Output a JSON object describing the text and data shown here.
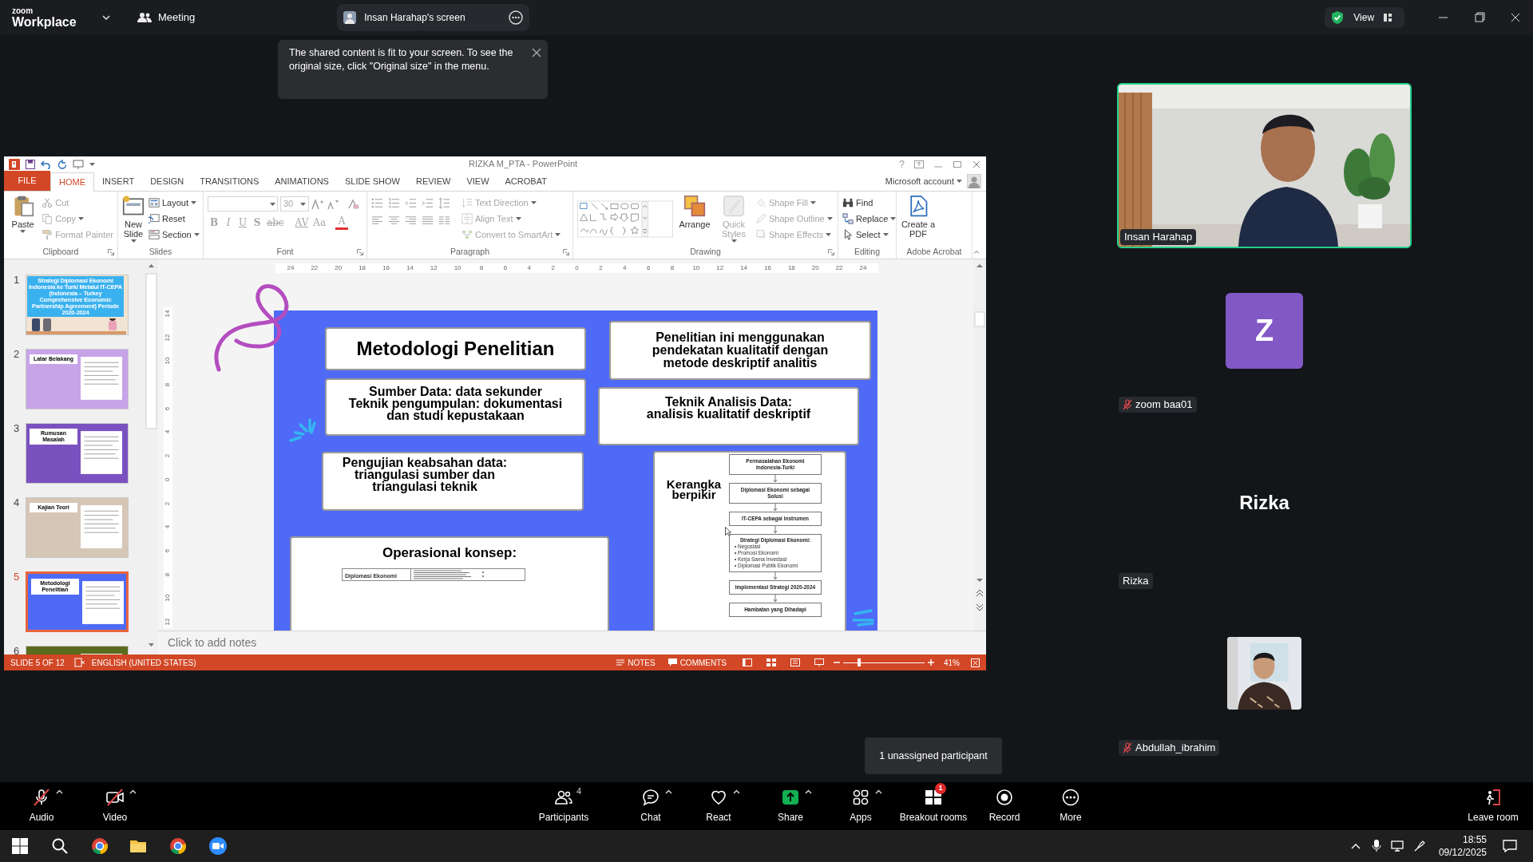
{
  "app_bar": {
    "logo": "zoom",
    "product": "Workplace",
    "meeting": "Meeting",
    "share_tab": "Insan Harahap's screen",
    "view": "View"
  },
  "notice": "The shared content is fit to your screen. To see the original size, click \"Original size\" in the menu.",
  "powerpoint": {
    "title": "RIZKA M_PTA - PowerPoint",
    "help": "?",
    "tabs": [
      {
        "label": "FILE",
        "kind": "file",
        "selected": false
      },
      {
        "label": "HOME",
        "kind": "tab",
        "selected": true
      },
      {
        "label": "INSERT",
        "kind": "tab",
        "selected": false
      },
      {
        "label": "DESIGN",
        "kind": "tab",
        "selected": false
      },
      {
        "label": "TRANSITIONS",
        "kind": "tab",
        "selected": false
      },
      {
        "label": "ANIMATIONS",
        "kind": "tab",
        "selected": false
      },
      {
        "label": "SLIDE SHOW",
        "kind": "tab",
        "selected": false
      },
      {
        "label": "REVIEW",
        "kind": "tab",
        "selected": false
      },
      {
        "label": "VIEW",
        "kind": "tab",
        "selected": false
      },
      {
        "label": "ACROBAT",
        "kind": "tab",
        "selected": false
      }
    ],
    "account": "Microsoft account",
    "ribbon": [
      {
        "label": "Clipboard",
        "kind": "basic",
        "launcher": true,
        "large": [
          {
            "label": "Paste",
            "menu": true,
            "disabled": false
          }
        ],
        "small": [
          {
            "label": "Cut",
            "menu": false,
            "disabled": true
          },
          {
            "label": "Copy",
            "menu": true,
            "disabled": true
          },
          {
            "label": "Format Painter",
            "menu": false,
            "disabled": true
          }
        ]
      },
      {
        "label": "Slides",
        "kind": "basic",
        "launcher": false,
        "large": [
          {
            "label": "New Slide",
            "menu": true,
            "disabled": false
          }
        ],
        "small": [
          {
            "label": "Layout",
            "menu": true,
            "disabled": false
          },
          {
            "label": "Reset",
            "menu": false,
            "disabled": false
          },
          {
            "label": "Section",
            "menu": true,
            "disabled": false
          }
        ]
      },
      {
        "label": "Font",
        "kind": "font",
        "launcher": true,
        "disabled": true,
        "size": "30",
        "buttons": [
          "B",
          "I",
          "U",
          "S",
          "abc",
          "AV",
          "Aa",
          "A"
        ]
      },
      {
        "label": "Paragraph",
        "kind": "paragraph",
        "launcher": true,
        "small": [
          {
            "label": "Text Direction",
            "menu": true,
            "disabled": true
          },
          {
            "label": "Align Text",
            "menu": true,
            "disabled": true
          },
          {
            "label": "Convert to SmartArt",
            "menu": true,
            "disabled": true
          }
        ]
      },
      {
        "label": "Drawing",
        "kind": "drawing",
        "launcher": true,
        "large": [
          {
            "label": "Arrange",
            "menu": false,
            "disabled": false
          },
          {
            "label": "Quick Styles",
            "menu": true,
            "disabled": true
          }
        ],
        "small": [
          {
            "label": "Shape Fill",
            "menu": true,
            "disabled": true
          },
          {
            "label": "Shape Outline",
            "menu": true,
            "disabled": true
          },
          {
            "label": "Shape Effects",
            "menu": true,
            "disabled": true
          }
        ]
      },
      {
        "label": "Editing",
        "kind": "basic",
        "launcher": false,
        "small": [
          {
            "label": "Find",
            "menu": false,
            "disabled": false
          },
          {
            "label": "Replace",
            "menu": true,
            "disabled": false
          },
          {
            "label": "Select",
            "menu": true,
            "disabled": false
          }
        ]
      },
      {
        "label": "Adobe Acrobat",
        "kind": "basic",
        "launcher": false,
        "large": [
          {
            "label": "Create a PDF",
            "menu": false,
            "disabled": false
          }
        ]
      }
    ],
    "thumbnails": [
      {
        "number": "1",
        "kind": "title",
        "color": "#f1e4d2",
        "label": "Strategi Diplomasi Ekonomi Indonesia ke Turki Melalui IT-CEPA (Indonesia – Turkey Comprehensive Economic Partnership Agreement) Periode 2020-2024",
        "selected": false
      },
      {
        "number": "2",
        "kind": "content",
        "color": "#c7a3e8",
        "label": "Latar Belakang",
        "selected": false
      },
      {
        "number": "3",
        "kind": "content",
        "color": "#7a52c0",
        "label": "Rumusan Masalah",
        "selected": false
      },
      {
        "number": "4",
        "kind": "content",
        "color": "#d6c6b6",
        "label": "Kajian Teori",
        "selected": false
      },
      {
        "number": "5",
        "kind": "content",
        "color": "#4f6af6",
        "label": "Metodologi Penelitian",
        "selected": true
      },
      {
        "number": "6",
        "kind": "content",
        "color": "#5b6a1d",
        "selected": false
      }
    ],
    "rulers": {
      "horizontal": [
        "24",
        "22",
        "20",
        "18",
        "16",
        "14",
        "12",
        "10",
        "8",
        "6",
        "4",
        "2",
        "0",
        "2",
        "4",
        "6",
        "8",
        "10",
        "12",
        "14",
        "16",
        "18",
        "20",
        "22",
        "24"
      ],
      "vertical": [
        "14",
        "12",
        "10",
        "8",
        "6",
        "4",
        "2",
        "0",
        "2",
        "4",
        "6",
        "8",
        "10",
        "12"
      ]
    },
    "slide": {
      "title": "Metodologi Penelitian",
      "boxes": [
        "Penelitian ini menggunakan\npendekatan kualitatif dengan\nmetode deskriptif analitis",
        "Sumber Data: data sekunder\nTeknik pengumpulan: dokumentasi\ndan studi kepustakaan",
        "Teknik Analisis Data:\nanalisis kualitatif deskriptif",
        "Pengujian keabsahan data:\ntriangulasi sumber dan\ntriangulasi teknik"
      ],
      "concept": {
        "title": "Operasional konsep:",
        "row_label": "Diplomasi Ekonomi"
      },
      "framework": {
        "title": "Kerangka\nberpikir",
        "steps": [
          {
            "text": "Permasalahan Ekonomi\nIndonesia-Turki"
          },
          {
            "text": "Diplomasi Ekonomi sebagai\nSolusi"
          },
          {
            "text": "IT-CEPA sebagai Instrumen"
          },
          {
            "text": "Strategi Diplomasi Ekonomi:",
            "bullets": [
              "Negosiasi",
              "Promosi Ekonomi",
              "Kerja Sama Investasi",
              "Diplomasi Publik Ekonomi"
            ]
          },
          {
            "text": "Implementasi Strategi 2020-2024"
          },
          {
            "text": "Hambatan yang Dihadapi"
          }
        ]
      }
    },
    "notes_placeholder": "Click to add notes",
    "status": {
      "slide": "SLIDE 5 OF 12",
      "language": "ENGLISH (UNITED STATES)",
      "notes": "NOTES",
      "comments": "COMMENTS",
      "zoom": "41%",
      "level": 0.2
    }
  },
  "participants": [
    {
      "name": "Insan Harahap",
      "kind": "video",
      "speaking": true,
      "muted": false
    },
    {
      "name": "zoom baa01",
      "kind": "avatar",
      "initial": "Z",
      "speaking": false,
      "muted": true
    },
    {
      "name": "Rizka",
      "kind": "name",
      "display": "Rizka",
      "speaking": false,
      "muted": false
    },
    {
      "name": "Abdullah_ibrahim",
      "speaking": false,
      "muted": true
    }
  ],
  "hint": "1 unassigned participant",
  "toolbar": [
    {
      "label": "Audio",
      "off": true,
      "menu": true
    },
    {
      "label": "Video",
      "off": true,
      "menu": true
    },
    {
      "label": "Participants",
      "count": "4",
      "off": false,
      "menu": false
    },
    {
      "label": "Chat",
      "off": false,
      "menu": true
    },
    {
      "label": "React",
      "off": false,
      "menu": true
    },
    {
      "label": "Share",
      "off": false,
      "menu": true
    },
    {
      "label": "Apps",
      "off": false,
      "menu": true
    },
    {
      "label": "Breakout rooms",
      "badge": "1",
      "off": false,
      "menu": false
    },
    {
      "label": "Record",
      "off": false,
      "menu": false
    },
    {
      "label": "More",
      "off": false,
      "menu": false
    },
    {
      "label": "Leave room",
      "off": false,
      "menu": false
    }
  ],
  "taskbar": {
    "time": "18:55",
    "date": "09/12/2025"
  }
}
